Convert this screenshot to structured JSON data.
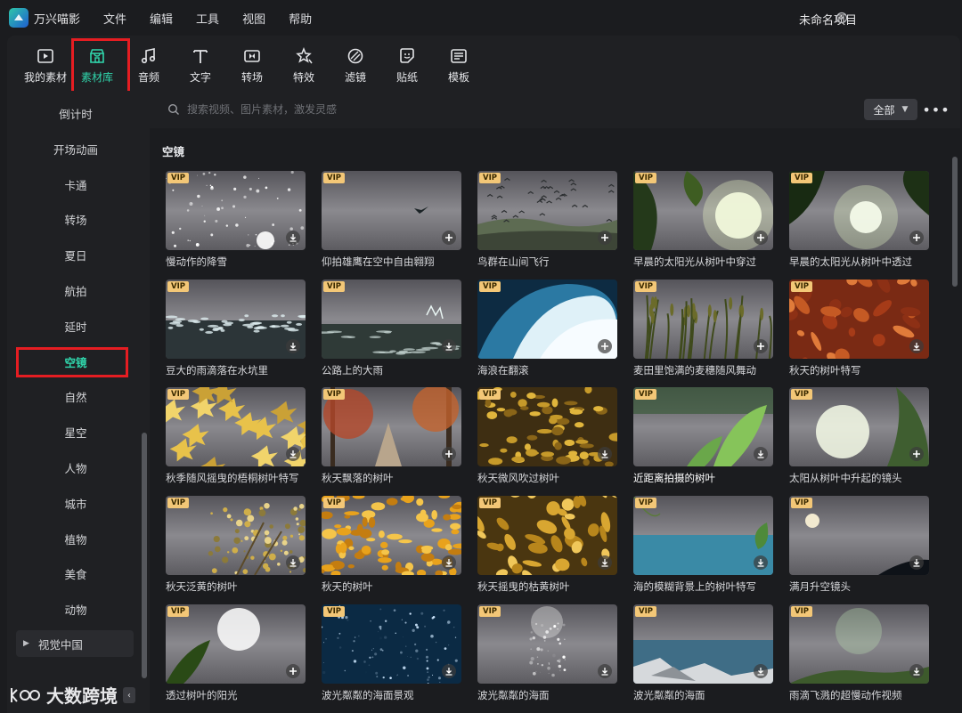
{
  "app": {
    "title": "万兴喵影",
    "project_name": "未命名项目"
  },
  "menu": [
    "文件",
    "编辑",
    "工具",
    "视图",
    "帮助"
  ],
  "toolbar": [
    {
      "label": "我的素材",
      "icon": "my-media-icon"
    },
    {
      "label": "素材库",
      "icon": "store-icon",
      "active": true
    },
    {
      "label": "音频",
      "icon": "music-note-icon"
    },
    {
      "label": "文字",
      "icon": "text-icon"
    },
    {
      "label": "转场",
      "icon": "transition-icon"
    },
    {
      "label": "特效",
      "icon": "effects-star-icon"
    },
    {
      "label": "滤镜",
      "icon": "filter-icon"
    },
    {
      "label": "贴纸",
      "icon": "sticker-icon"
    },
    {
      "label": "模板",
      "icon": "template-icon"
    }
  ],
  "sidebar": {
    "items": [
      "倒计时",
      "开场动画",
      "卡通",
      "转场",
      "夏日",
      "航拍",
      "延时",
      "空镜",
      "自然",
      "星空",
      "人物",
      "城市",
      "植物",
      "美食",
      "动物"
    ],
    "active": "空镜",
    "group": "视觉中国"
  },
  "search": {
    "placeholder": "搜索视频、图片素材，激发灵感"
  },
  "filter": {
    "label": "全部"
  },
  "section_title": "空镜",
  "cards": [
    {
      "label": "慢动作的降雪",
      "vip": "VIP",
      "action": "download",
      "scene": "snow"
    },
    {
      "label": "仰拍雄鹰在空中自由翱翔",
      "vip": "VIP",
      "action": "add",
      "scene": "eagle"
    },
    {
      "label": "鸟群在山间飞行",
      "vip": "VIP",
      "action": "add",
      "scene": "birds"
    },
    {
      "label": "早晨的太阳光从树叶中穿过",
      "vip": "VIP",
      "action": "add",
      "scene": "sunleaf"
    },
    {
      "label": "早晨的太阳光从树叶中透过",
      "vip": "VIP",
      "action": "add",
      "scene": "sunleaf2"
    },
    {
      "label": "豆大的雨滴落在水坑里",
      "vip": "VIP",
      "action": "download",
      "scene": "rain"
    },
    {
      "label": "公路上的大雨",
      "vip": "VIP",
      "action": "download",
      "scene": "rain2"
    },
    {
      "label": "海浪在翻滚",
      "vip": "VIP",
      "action": "add",
      "scene": "wave"
    },
    {
      "label": "麦田里饱满的麦穗随风舞动",
      "vip": "VIP",
      "action": "add",
      "scene": "wheat"
    },
    {
      "label": "秋天的树叶特写",
      "vip": "VIP",
      "action": "download",
      "scene": "leaves"
    },
    {
      "label": "秋季随风摇曳的梧桐树叶特写",
      "vip": "VIP",
      "action": "download",
      "scene": "maple"
    },
    {
      "label": "秋天飘落的树叶",
      "vip": "VIP",
      "action": "add",
      "scene": "forest"
    },
    {
      "label": "秋天微风吹过树叶",
      "vip": "VIP",
      "action": "download",
      "scene": "ground"
    },
    {
      "label": "近距离拍摄的树叶",
      "vip": "VIP",
      "action": "download",
      "scene": "closeleaf",
      "hover": true
    },
    {
      "label": "太阳从树叶中升起的镜头",
      "vip": "VIP",
      "action": "add",
      "scene": "sunrise"
    },
    {
      "label": "秋天泛黄的树叶",
      "vip": "VIP",
      "action": "download",
      "scene": "yellowtree"
    },
    {
      "label": "秋天的树叶",
      "vip": "VIP",
      "action": "download",
      "scene": "autumn"
    },
    {
      "label": "秋天摇曳的枯黄树叶",
      "vip": "VIP",
      "action": "download",
      "scene": "goldleaf"
    },
    {
      "label": "海的模糊背景上的树叶特写",
      "vip": "VIP",
      "action": "download",
      "scene": "sea"
    },
    {
      "label": "满月升空镜头",
      "vip": "VIP",
      "action": "download",
      "scene": "moon"
    },
    {
      "label": "透过树叶的阳光",
      "vip": "VIP",
      "action": "add",
      "scene": "sunthrough"
    },
    {
      "label": "波光粼粼的海面景观",
      "vip": "VIP",
      "action": "download",
      "scene": "ocean"
    },
    {
      "label": "波光粼粼的海面",
      "vip": "VIP",
      "action": "download",
      "scene": "darksea"
    },
    {
      "label": "波光粼粼的海面",
      "vip": "VIP",
      "action": "download",
      "scene": "rocks"
    },
    {
      "label": "雨滴飞溅的超慢动作视频",
      "vip": "VIP",
      "action": "download",
      "scene": "grassrain"
    }
  ],
  "watermark": "大数跨境",
  "colors": {
    "accent": "#30d6ac",
    "highlight": "#e51d22",
    "vip": "#f3c777"
  }
}
